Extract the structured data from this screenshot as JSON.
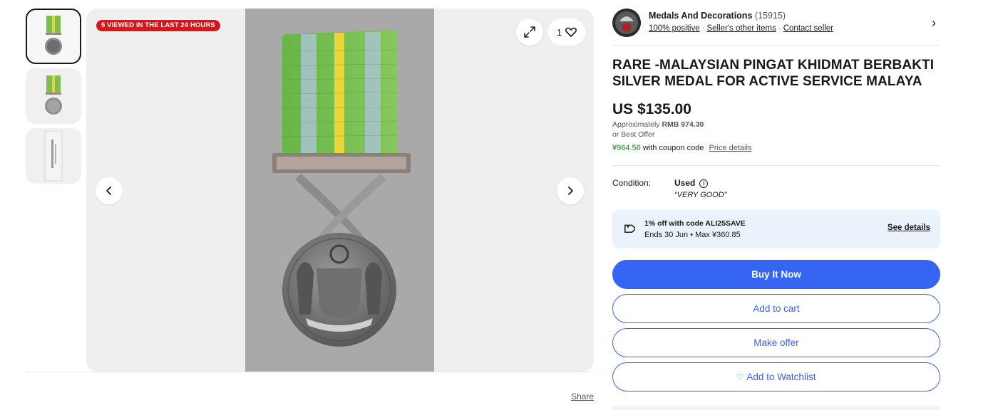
{
  "gallery": {
    "viewed_badge": "5 VIEWED IN THE LAST 24 HOURS",
    "watch_count": "1",
    "expand_icon": "expand-icon",
    "heart_icon": "heart-icon",
    "prev_icon": "chevron-left-icon",
    "next_icon": "chevron-right-icon",
    "thumbnails": [
      "medal-front-thumbnail",
      "medal-back-thumbnail",
      "medal-packaging-thumbnail"
    ],
    "share_label": "Share"
  },
  "seller": {
    "name": "Medals And Decorations",
    "feedback_count": "(15915)",
    "positive": "100% positive",
    "other_items": "Seller's other items",
    "contact": "Contact seller",
    "chevron": "›"
  },
  "listing": {
    "title": "RARE -MALAYSIAN PINGAT KHIDMAT BERBAKTI SILVER MEDAL FOR ACTIVE SERVICE MALAYA",
    "price": "US $135.00",
    "approx_prefix": "Approximately",
    "approx_value": "RMB 974.30",
    "best_offer": "or Best Offer",
    "coupon_price": "¥964.56",
    "coupon_text": "with coupon code",
    "price_details": "Price details"
  },
  "condition": {
    "label": "Condition:",
    "value": "Used",
    "info_icon": "i",
    "note": "“VERY GOOD”"
  },
  "promo": {
    "line1": "1% off with code ALI25SAVE",
    "line2": "Ends 30 Jun • Max ¥360.85",
    "see_details": "See details"
  },
  "actions": {
    "buy_now": "Buy It Now",
    "add_to_cart": "Add to cart",
    "make_offer": "Make offer",
    "watchlist_heart": "♡",
    "add_to_watchlist": "Add to Watchlist"
  },
  "colors": {
    "brand_blue": "#3665f3",
    "badge_red": "#d5161b",
    "promo_bg": "#eaf3fc",
    "coupon_green": "#1b7a1b"
  }
}
